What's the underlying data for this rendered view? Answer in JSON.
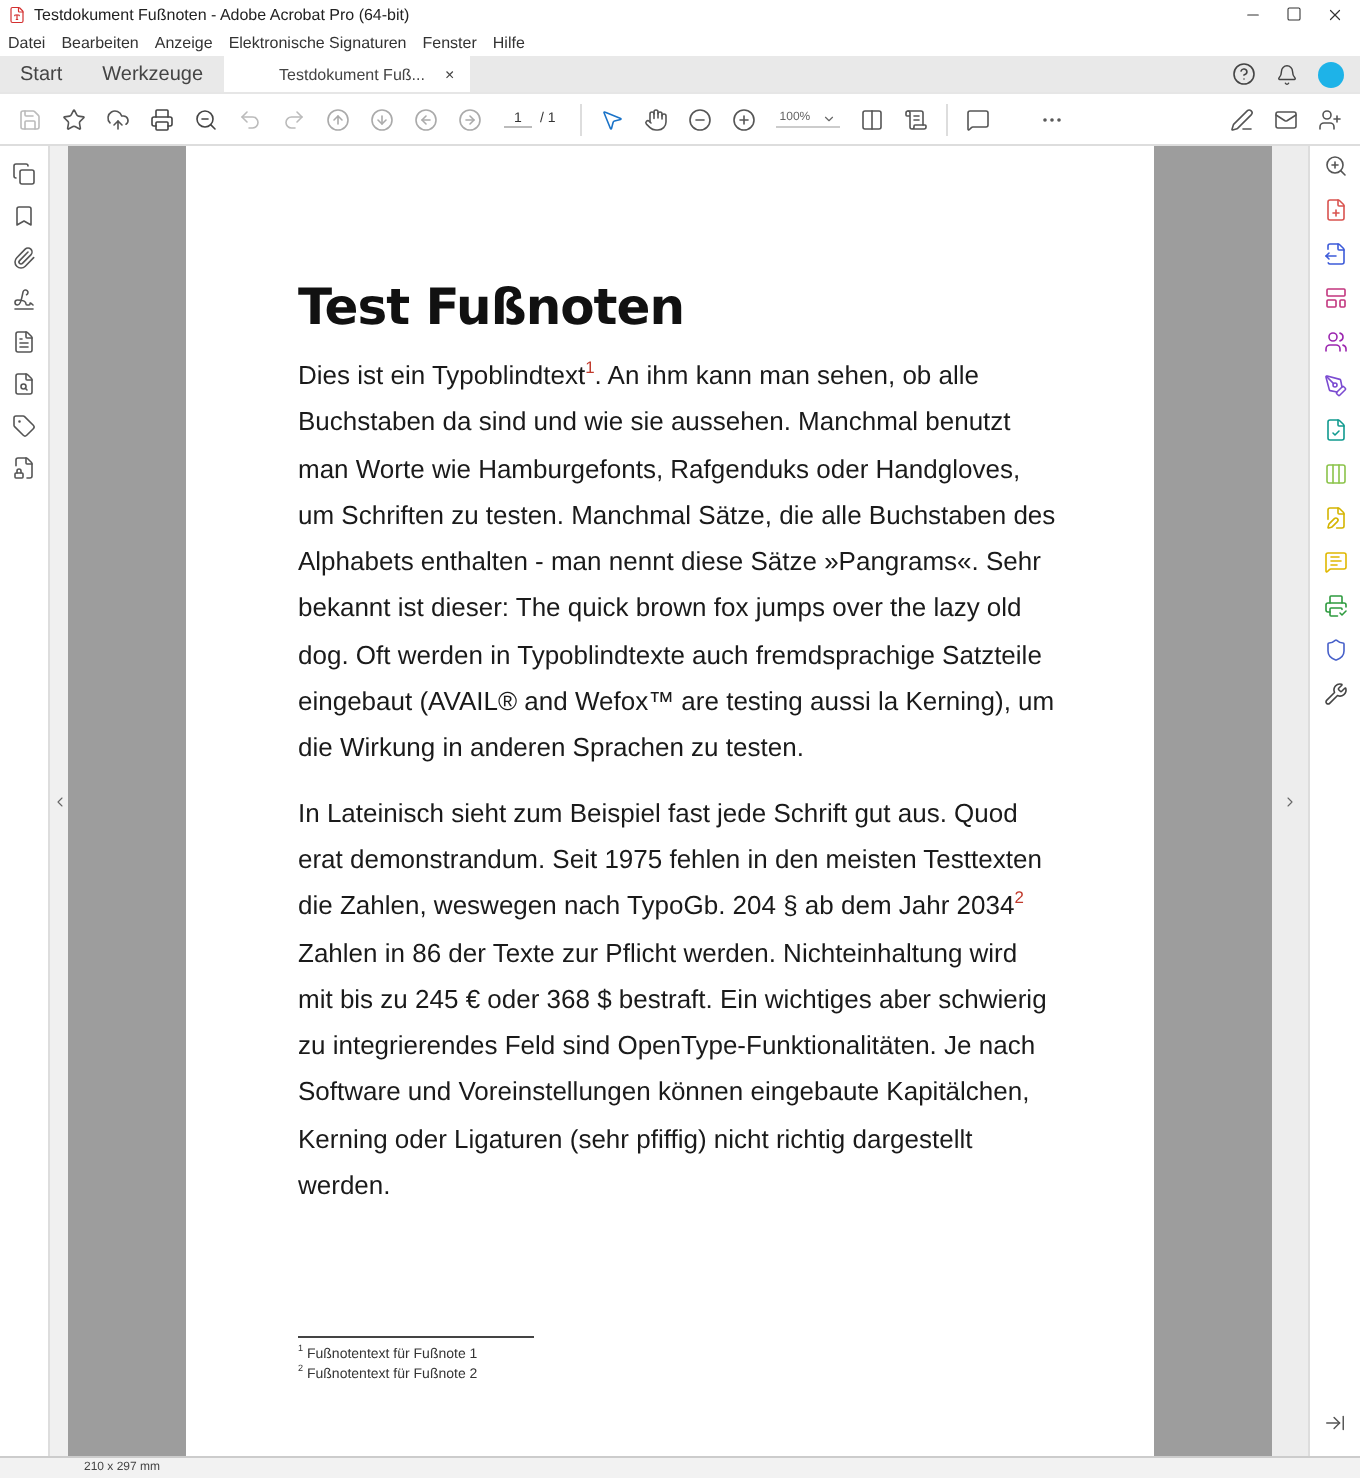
{
  "window": {
    "title": "Testdokument Fußnoten - Adobe Acrobat Pro (64-bit)"
  },
  "menu": [
    "Datei",
    "Bearbeiten",
    "Anzeige",
    "Elektronische Signaturen",
    "Fenster",
    "Hilfe"
  ],
  "tabs": [
    {
      "label": "Start",
      "kind": "home",
      "selected": false
    },
    {
      "label": "Werkzeuge",
      "kind": "home",
      "selected": false
    },
    {
      "label": "Testdokument Fuß...",
      "kind": "document",
      "selected": true,
      "close": "×"
    }
  ],
  "toolbar": {
    "page": "1",
    "page_count": "/ 1",
    "zoom": "100%"
  },
  "document": {
    "heading": "Test Fußnoten",
    "paragraphs": [
      "Dies ist ein Typoblindtext$^{1}$. An ihm kann man sehen, ob alle Buchstaben da sind und wie sie aussehen. Manchmal benutzt man Worte wie Hamburgefonts, Rafgenduks oder Handgloves, um Schriften zu testen. Manchmal Sätze, die alle Buchstaben des Alphabets enthalten - man nennt diese Sätze »Pangrams«. Sehr bekannt ist dieser: The quick brown fox jumps over the lazy old dog. Oft werden in Typoblindtexte auch fremdsprachige Satzteile eingebaut (AVAIL® and Wefox™ are testing aussi la Kerning), um die Wirkung in anderen Sprachen zu testen.",
      "In Lateinisch sieht zum Beispiel fast jede Schrift gut aus. Quod erat demonstrandum. Seit 1975 fehlen in den meisten Testtexten die Zahlen, weswegen nach TypoGb. 204 § ab dem Jahr 2034$^{2}$ Zahlen in 86 der Texte zur Pflicht werden. Nichteinhaltung wird mit bis zu 245 € oder 368 $ bestraft. Ein wichtiges aber schwierig zu integrierendes Feld sind OpenType-Funktionalitäten. Je nach Software und Voreinstellungen können eingebaute Kapitälchen, Kerning oder Ligaturen (sehr pfiffig) nicht richtig dargestellt werden."
    ],
    "footnotes": [
      "$^{1}$ Fußnotentext für Fußnote 1",
      "$^{2}$ Fußnotentext für Fußnote 2"
    ]
  },
  "status_bar": {
    "page_size": "210 x 297 mm"
  }
}
